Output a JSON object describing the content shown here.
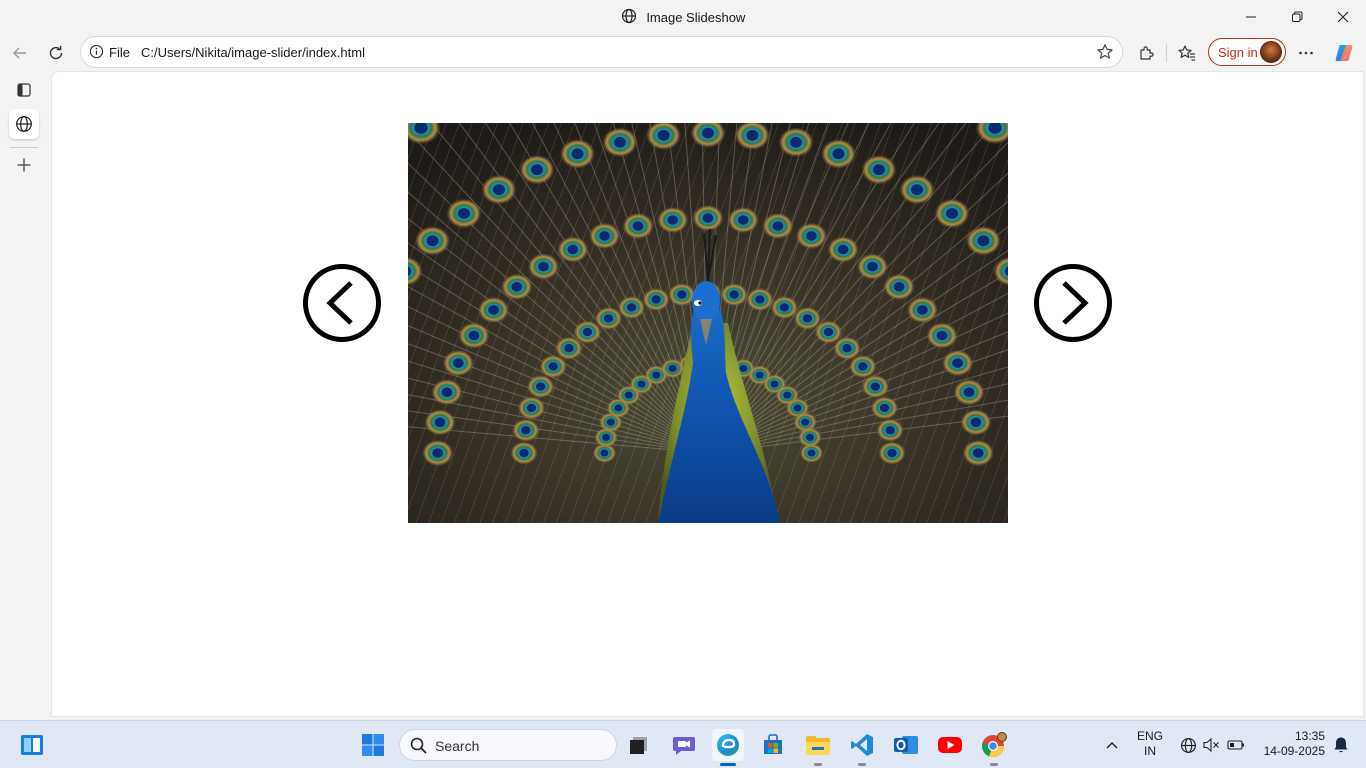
{
  "window": {
    "title": "Image Slideshow"
  },
  "address_bar": {
    "scheme_label": "File",
    "url": "C:/Users/Nikita/image-slider/index.html"
  },
  "profile": {
    "sign_in_label": "Sign in"
  },
  "slideshow": {
    "image_alt": "Peacock displaying feathers",
    "prev_icon": "chevron-left-circle",
    "next_icon": "chevron-right-circle"
  },
  "taskbar": {
    "search_placeholder": "Search",
    "language": [
      "ENG",
      "IN"
    ],
    "time": "13:35",
    "date": "14-09-2025"
  },
  "colors": {
    "signin_accent": "#c42b1c",
    "taskbar_bg": "#dfe8f4",
    "edge_indicator": "#0067c0"
  }
}
